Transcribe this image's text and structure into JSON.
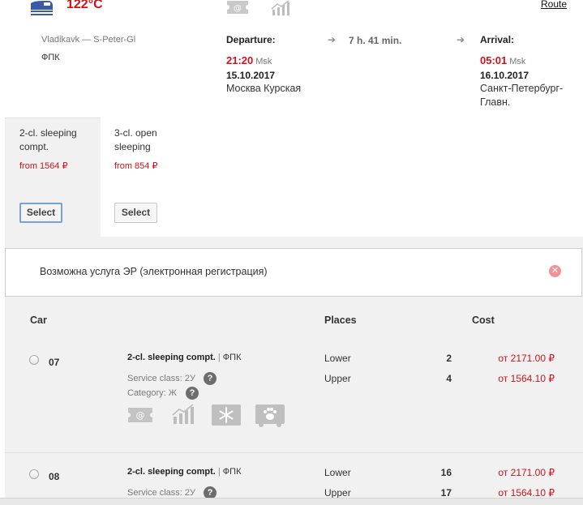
{
  "train": {
    "number": "122°C",
    "route_link": "Route",
    "route_name": "Vladikavk — S-Peter-Gl",
    "carrier": "ФПК",
    "departure": {
      "label": "Departure:",
      "time": "21:20",
      "tz": "Msk",
      "date": "15.10.2017",
      "station": "Москва Курская"
    },
    "duration": "7 h. 41 min.",
    "arrival": {
      "label": "Arrival:",
      "time": "05:01",
      "tz": "Msk",
      "date": "16.10.2017",
      "station_line1": "Санкт-Петербург-",
      "station_line2": "Главн."
    },
    "icons": [
      "e-ticket-icon",
      "bar-chart-icon"
    ]
  },
  "classes": [
    {
      "title_line1": "2-cl. sleeping",
      "title_line2": "compt.",
      "price": "from 1564 ₽",
      "button": "Select",
      "active": true
    },
    {
      "title_line1": "3-cl. open",
      "title_line2": "sleeping",
      "price": "from 854 ₽",
      "button": "Select",
      "active": false
    }
  ],
  "notice": {
    "text": "Возможна услуга ЭР (электронная регистрация)"
  },
  "table": {
    "headers": {
      "car": "Car",
      "places": "Places",
      "cost": "Cost"
    },
    "cars": [
      {
        "number": "07",
        "class_name": "2-cl. sleeping compt.",
        "separator": "|",
        "carrier": "ФПК",
        "service_class": "Service class: 2У",
        "category": "Category: Ж",
        "places": [
          {
            "type": "Lower",
            "count": "2",
            "price": "от 2171.00 ₽"
          },
          {
            "type": "Upper",
            "count": "4",
            "price": "от 1564.10 ₽"
          }
        ],
        "amenities": [
          "e-ticket-icon",
          "bar-chart-icon",
          "snowflake-icon",
          "pet-transport-icon"
        ]
      },
      {
        "number": "08",
        "class_name": "2-cl. sleeping compt.",
        "separator": "|",
        "carrier": "ФПК",
        "service_class": "Service class: 2У",
        "places": [
          {
            "type": "Lower",
            "count": "16",
            "price": "от 2171.00 ₽"
          },
          {
            "type": "Upper",
            "count": "17",
            "price": "от 1564.10 ₽"
          }
        ]
      }
    ]
  },
  "colors": {
    "accent_red": "#d0131b",
    "panel_grey": "#f1f1f1",
    "select_focus": "#7aa0d8"
  }
}
